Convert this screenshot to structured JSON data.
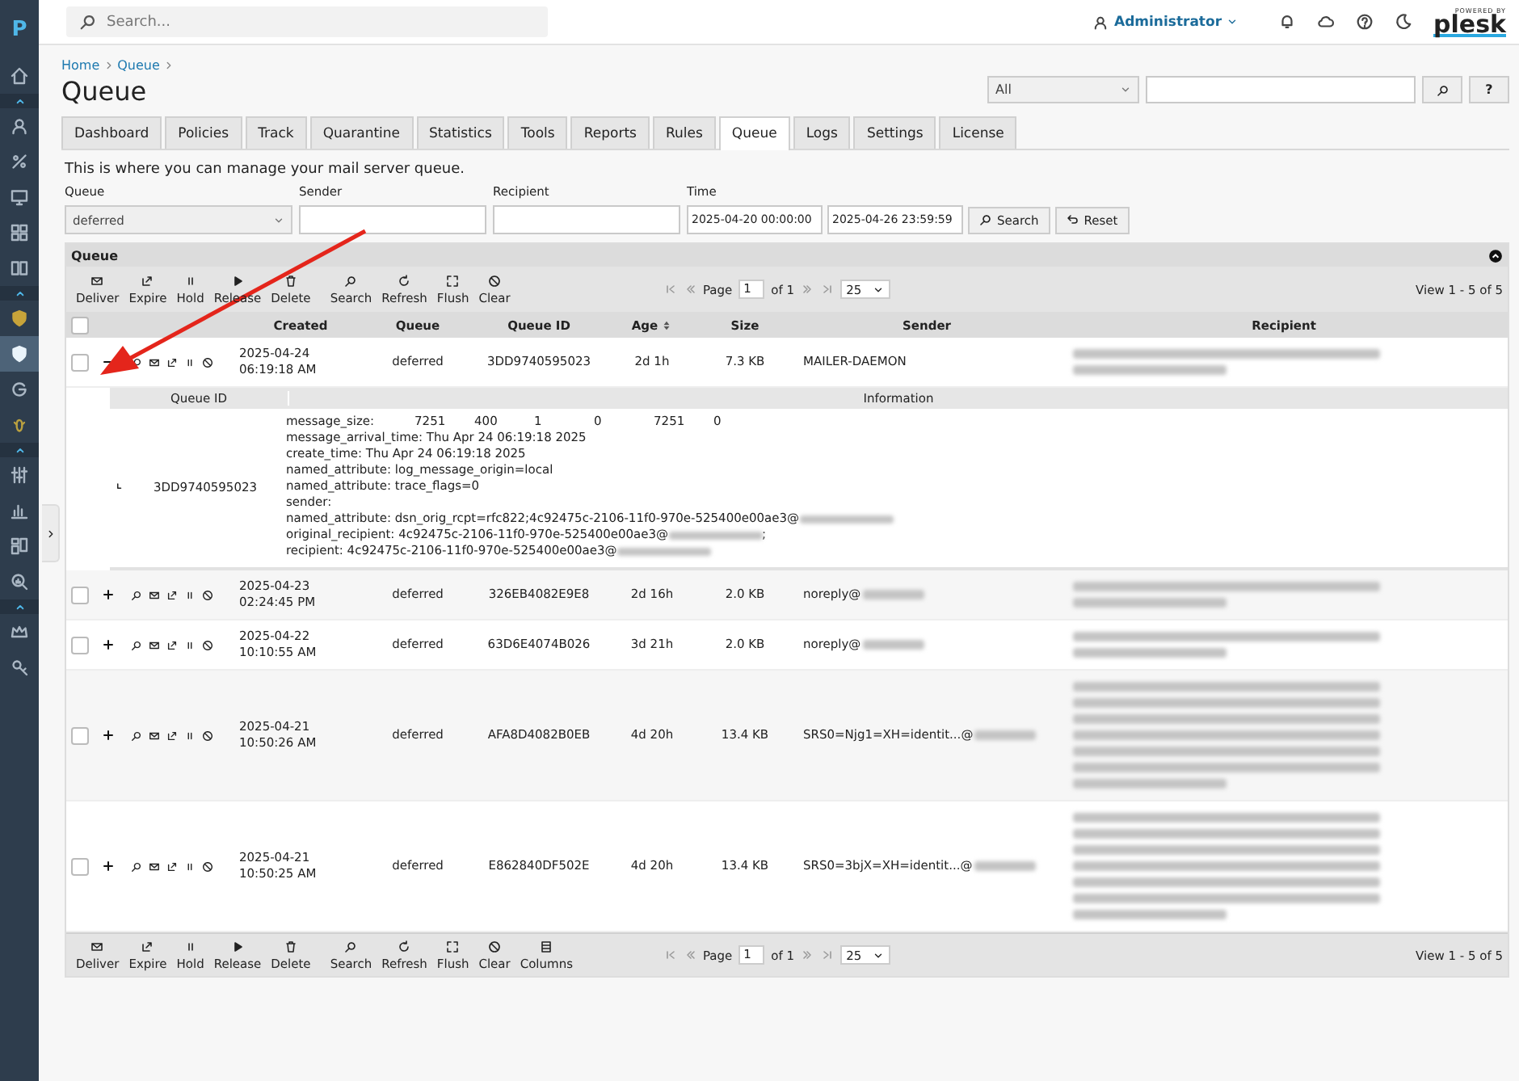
{
  "sidebar": {
    "logo": "P",
    "items": [
      {
        "kind": "home",
        "selected": false
      },
      {
        "kind": "section",
        "selected": false
      },
      {
        "kind": "user",
        "selected": false
      },
      {
        "kind": "percent",
        "selected": false
      },
      {
        "kind": "monitor",
        "selected": false
      },
      {
        "kind": "grid",
        "selected": false
      },
      {
        "kind": "book",
        "selected": false
      },
      {
        "kind": "section",
        "selected": false
      },
      {
        "kind": "shield-gold",
        "selected": false
      },
      {
        "kind": "shield",
        "selected": true
      },
      {
        "kind": "g",
        "selected": false
      },
      {
        "kind": "bee",
        "selected": false
      },
      {
        "kind": "section",
        "selected": false
      },
      {
        "kind": "sliders",
        "selected": false
      },
      {
        "kind": "chart",
        "selected": false
      },
      {
        "kind": "tiles",
        "selected": false
      },
      {
        "kind": "stats",
        "selected": false
      },
      {
        "kind": "section",
        "selected": false
      },
      {
        "kind": "crown",
        "selected": false
      },
      {
        "kind": "key",
        "selected": false
      }
    ]
  },
  "header": {
    "search": {
      "placeholder": "Search..."
    },
    "user": "Administrator",
    "icons": [
      {
        "kind": "bell"
      },
      {
        "kind": "cloud"
      },
      {
        "kind": "help"
      },
      {
        "kind": "moon"
      }
    ],
    "brand": {
      "tagline": "POWERED BY",
      "name": "plesk"
    }
  },
  "breadcrumb": [
    "Home",
    "Queue"
  ],
  "title": "Queue",
  "global_search": {
    "scope": "All",
    "help": "?"
  },
  "tabs": [
    {
      "label": "Dashboard",
      "selected": false
    },
    {
      "label": "Policies",
      "selected": false
    },
    {
      "label": "Track",
      "selected": false
    },
    {
      "label": "Quarantine",
      "selected": false
    },
    {
      "label": "Statistics",
      "selected": false
    },
    {
      "label": "Tools",
      "selected": false
    },
    {
      "label": "Reports",
      "selected": false
    },
    {
      "label": "Rules",
      "selected": false
    },
    {
      "label": "Queue",
      "selected": true
    },
    {
      "label": "Logs",
      "selected": false
    },
    {
      "label": "Settings",
      "selected": false
    },
    {
      "label": "License",
      "selected": false
    }
  ],
  "description": "This is where you can manage your mail server queue.",
  "filters": {
    "queue": {
      "label": "Queue",
      "value": "deferred"
    },
    "sender": {
      "label": "Sender"
    },
    "recipient": {
      "label": "Recipient"
    },
    "time": {
      "label": "Time",
      "from": "2025-04-20 00:00:00",
      "to": "2025-04-26 23:59:59"
    },
    "buttons": [
      {
        "label": "Search",
        "kind": "search"
      },
      {
        "label": "Reset",
        "kind": "reset"
      }
    ]
  },
  "panel": {
    "title": "Queue",
    "toolbar": [
      {
        "label": "Deliver",
        "kind": "envelope"
      },
      {
        "label": "Expire",
        "kind": "expire"
      },
      {
        "label": "Hold",
        "kind": "pause"
      },
      {
        "label": "Release",
        "kind": "play"
      },
      {
        "label": "Delete",
        "kind": "trash"
      },
      {
        "label": "Search",
        "kind": "search"
      },
      {
        "label": "Refresh",
        "kind": "refresh"
      },
      {
        "label": "Flush",
        "kind": "flush"
      },
      {
        "label": "Clear",
        "kind": "ban"
      }
    ],
    "pager": {
      "page_label": "Page",
      "page": "1",
      "of": "of 1",
      "per_page": "25",
      "view": "View 1 - 5 of 5"
    },
    "select_all": {
      "checked": false
    },
    "columns": [
      {
        "label": "Created",
        "sorted": false
      },
      {
        "label": "Queue",
        "sorted": false
      },
      {
        "label": "Queue ID",
        "sorted": false
      },
      {
        "label": "Age",
        "sorted": true
      },
      {
        "label": "Size",
        "sorted": false
      },
      {
        "label": "Sender",
        "sorted": false
      },
      {
        "label": "Recipient",
        "sorted": false
      }
    ],
    "rows": [
      {
        "checked": false,
        "expanded": true,
        "created": "2025-04-24 06:19:18 AM",
        "queue": "deferred",
        "queue_id": "3DD9740595023",
        "age": "2d 1h",
        "size": "7.3 KB",
        "sender": "MAILER-DAEMON",
        "sender_redacted": false,
        "recipient_blur": [
          {
            "full": true
          },
          {
            "full": false
          }
        ],
        "detail": {
          "columns": [
            "Queue ID",
            "Information"
          ],
          "queue_id": "3DD9740595023",
          "lines": [
            {
              "parts": [
                "message_size:",
                "7251",
                "400",
                "1",
                "0",
                "7251",
                "0"
              ],
              "redacted": false
            },
            {
              "parts": [
                "message_arrival_time: Thu Apr 24 06:19:18 2025"
              ],
              "redacted": false
            },
            {
              "parts": [
                "create_time: Thu Apr 24 06:19:18 2025"
              ],
              "redacted": false
            },
            {
              "parts": [
                "named_attribute: log_message_origin=local"
              ],
              "redacted": false
            },
            {
              "parts": [
                "named_attribute: trace_flags=0"
              ],
              "redacted": false
            },
            {
              "parts": [
                "sender:"
              ],
              "redacted": false
            },
            {
              "parts": [
                "named_attribute: dsn_orig_rcpt=rfc822;4c92475c-2106-11f0-970e-525400e00ae3@"
              ],
              "redacted": true
            },
            {
              "parts": [
                "original_recipient: 4c92475c-2106-11f0-970e-525400e00ae3@"
              ],
              "redacted": true,
              "suffix": ";"
            },
            {
              "parts": [
                "recipient: 4c92475c-2106-11f0-970e-525400e00ae3@"
              ],
              "redacted": true
            }
          ]
        }
      },
      {
        "checked": false,
        "expanded": false,
        "created": "2025-04-23 02:24:45 PM",
        "queue": "deferred",
        "queue_id": "326EB4082E9E8",
        "age": "2d 16h",
        "size": "2.0 KB",
        "sender": "noreply@",
        "sender_redacted": true,
        "recipient_blur": [
          {
            "full": true
          },
          {
            "full": false
          }
        ]
      },
      {
        "checked": false,
        "expanded": false,
        "created": "2025-04-22 10:10:55 AM",
        "queue": "deferred",
        "queue_id": "63D6E4074B026",
        "age": "3d 21h",
        "size": "2.0 KB",
        "sender": "noreply@",
        "sender_redacted": true,
        "recipient_blur": [
          {
            "full": true
          },
          {
            "full": false
          }
        ]
      },
      {
        "checked": false,
        "expanded": false,
        "created": "2025-04-21 10:50:26 AM",
        "queue": "deferred",
        "queue_id": "AFA8D4082B0EB",
        "age": "4d 20h",
        "size": "13.4 KB",
        "sender": "SRS0=Njg1=XH=identit...@",
        "sender_redacted": true,
        "recipient_blur": [
          {
            "full": true
          },
          {
            "full": true
          },
          {
            "full": true
          },
          {
            "full": true
          },
          {
            "full": true
          },
          {
            "full": true
          },
          {
            "full": false
          }
        ]
      },
      {
        "checked": false,
        "expanded": false,
        "created": "2025-04-21 10:50:25 AM",
        "queue": "deferred",
        "queue_id": "E862840DF502E",
        "age": "4d 20h",
        "size": "13.4 KB",
        "sender": "SRS0=3bjX=XH=identit...@",
        "sender_redacted": true,
        "recipient_blur": [
          {
            "full": true
          },
          {
            "full": true
          },
          {
            "full": true
          },
          {
            "full": true
          },
          {
            "full": true
          },
          {
            "full": true
          },
          {
            "full": false
          }
        ]
      }
    ],
    "bottom_toolbar": [
      {
        "label": "Deliver",
        "kind": "envelope"
      },
      {
        "label": "Expire",
        "kind": "expire"
      },
      {
        "label": "Hold",
        "kind": "pause"
      },
      {
        "label": "Release",
        "kind": "play"
      },
      {
        "label": "Delete",
        "kind": "trash"
      },
      {
        "label": "Search",
        "kind": "search"
      },
      {
        "label": "Refresh",
        "kind": "refresh"
      },
      {
        "label": "Flush",
        "kind": "flush"
      },
      {
        "label": "Clear",
        "kind": "ban"
      },
      {
        "label": "Columns",
        "kind": "columns"
      }
    ],
    "bottom_pager": {
      "page_label": "Page",
      "page": "1",
      "of": "of 1",
      "per_page": "25",
      "view": "View 1 - 5 of 5"
    }
  },
  "annotation": {
    "kind": "arrow"
  }
}
